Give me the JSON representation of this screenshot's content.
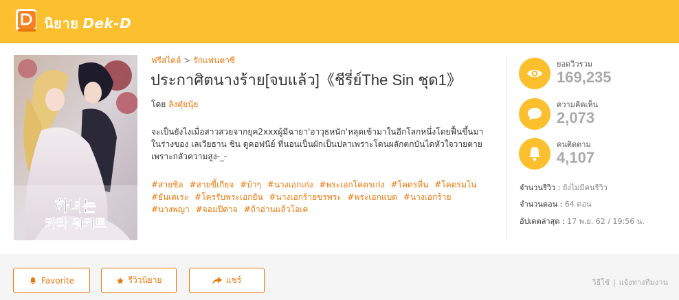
{
  "header": {
    "logo_icon": "dek-d-book-icon",
    "logo_thai": "นิยาย",
    "logo_brand": "Dek-D",
    "bg_color": "#fcc02e"
  },
  "breadcrumb": {
    "category": "ฟรีสไตล์",
    "separator": ">",
    "subcategory": "รักแฟนตาซี"
  },
  "novel": {
    "title": "ประกาศิตนางร้าย[จบแล้ว]《ชีรี่ย์The Sin ชุด1》",
    "author_prefix": "โดย",
    "author_name": "ลิงตุ๋ยนุ้ย",
    "description": "จะเป็นยังไงเมื่อสาวสวยจากยุค2xxxผู้มีฉายา'อาวุธหนัก'หลุดเข้ามาในอีกโลกหนึ่งโดยฟื้นขึ้นมาในร่างของ เลเวียธาน ชิน ดูคอฟนีย์ ที่นอนเป็นผักเป็นปลาเพราะโดนผลักตกบันไดหัวใจวายตายเพราะกลัวความสูง-_-",
    "tags": [
      "#สายชิล",
      "#สายขี้เกียจ",
      "#บ้าๆ",
      "#นางเอกเก่ง",
      "#พระเอกโคตรเก่ง",
      "#โคตรหื่น",
      "#โคตรมโน",
      "#ยันเดเระ",
      "#โครรับพระเอกยัน",
      "#นางเอกร้ายขรพระ",
      "#พระเอกแบด",
      "#นางเอกร้าย",
      "#นางพญา",
      "#จอมปีศาจ",
      "#ถ้าอ่านแล้วโอเค"
    ],
    "cover_alt_text": "하녀는 카타 워키트"
  },
  "stats": [
    {
      "icon": "eye-icon",
      "label": "ยอดวิวรวม",
      "value": "169,235"
    },
    {
      "icon": "comment-icon",
      "label": "ความคิดเห็น",
      "value": "2,073"
    },
    {
      "icon": "bell-icon",
      "label": "คนติดตาม",
      "value": "4,107"
    }
  ],
  "meta": {
    "reviews_label": "จำนวนรีวิว :",
    "reviews_value": "ยังไม่มีคนรีวิว",
    "episodes_label": "จำนวนตอน :",
    "episodes_value": "64 ตอน",
    "updated_label": "อัปเดตล่าสุด :",
    "updated_value": "17 พ.ย. 62 / 19:56 น."
  },
  "actions": {
    "favorite": "Favorite",
    "review": "รีวิวนิยาย",
    "share": "แชร์"
  },
  "footer_links": {
    "how_to": "วิธีใช้",
    "separator": "|",
    "report": "แจ้งทางทีมงาน"
  }
}
